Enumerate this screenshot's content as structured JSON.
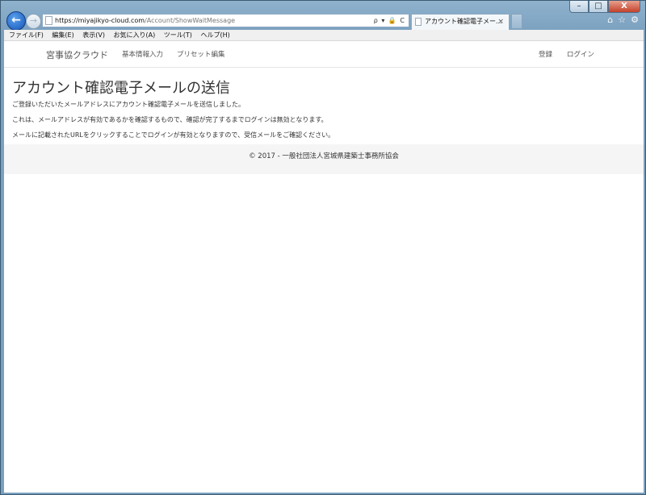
{
  "browser": {
    "address": {
      "host": "https://miyajikyo-cloud.com",
      "path": "/Account/ShowWaitMessage",
      "tools": "ρ ▾ 🔒 C"
    },
    "tab_title": "アカウント確認電子メー...",
    "tab_close": "×",
    "caption": {
      "minimize": "–",
      "restore": "□",
      "close": "X"
    },
    "right_icons": [
      "⌂",
      "☆",
      "⚙"
    ]
  },
  "menubar": [
    "ファイル(F)",
    "編集(E)",
    "表示(V)",
    "お気に入り(A)",
    "ツール(T)",
    "ヘルプ(H)"
  ],
  "site": {
    "brand": "宮事協クラウド",
    "nav_left": [
      "基本情報入力",
      "プリセット編集"
    ],
    "nav_right": [
      "登録",
      "ログイン"
    ]
  },
  "page": {
    "heading": "アカウント確認電子メールの送信",
    "paragraphs": [
      "ご登録いただいたメールアドレスにアカウント確認電子メールを送信しました。",
      "これは、メールアドレスが有効であるかを確認するもので、確認が完了するまでログインは無効となります。",
      "メールに記載されたURLをクリックすることでログインが有効となりますので、受信メールをご確認ください。"
    ],
    "footer": "© 2017 - 一般社団法人宮城県建築士事務所協会"
  }
}
